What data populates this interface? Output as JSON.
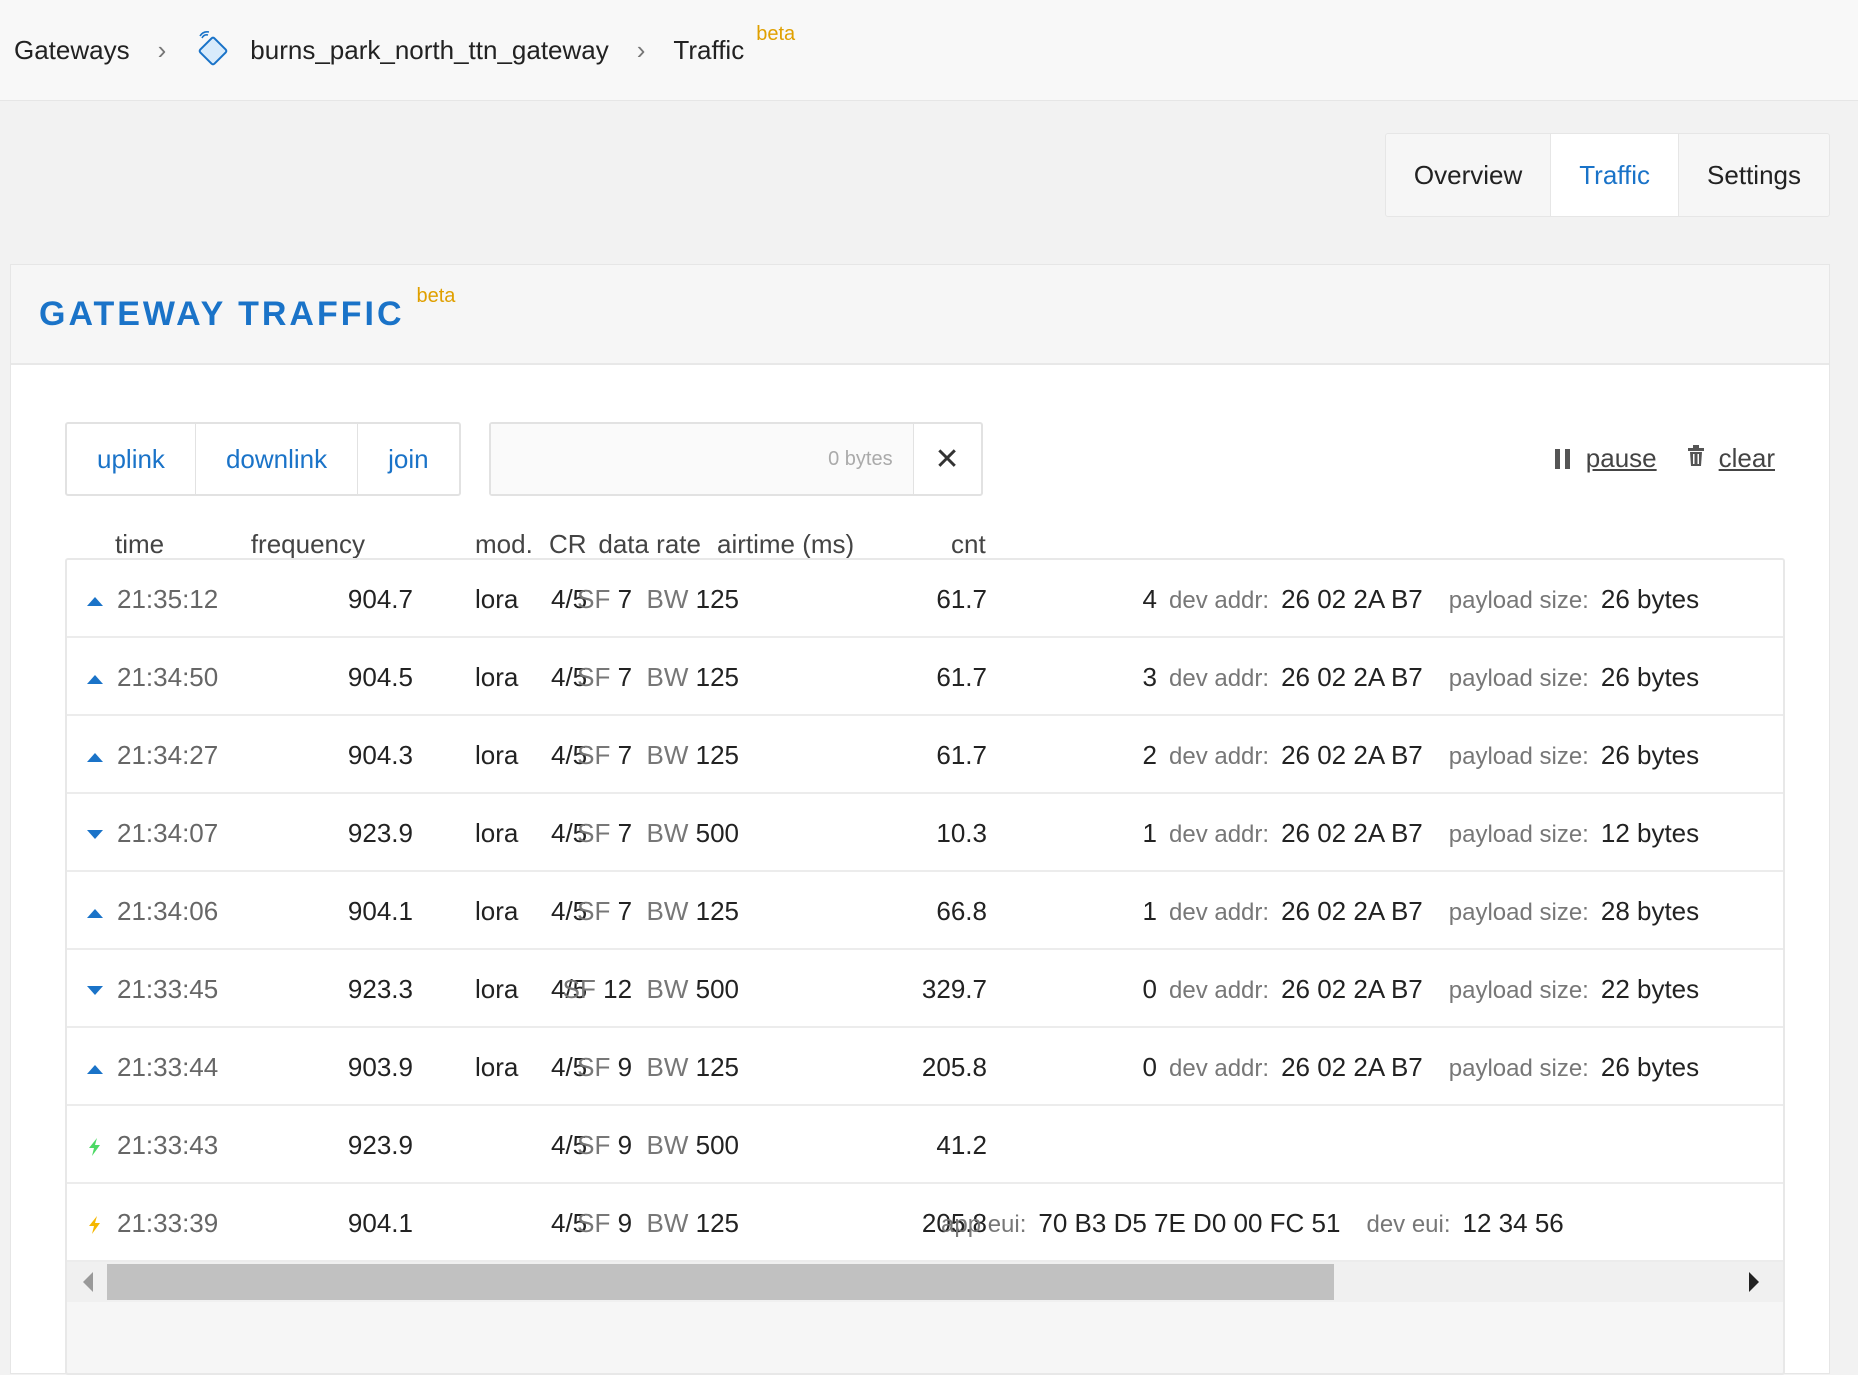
{
  "breadcrumb": {
    "gateways": "Gateways",
    "gateway_id": "burns_park_north_ttn_gateway",
    "current": "Traffic",
    "beta": "beta"
  },
  "tabs": [
    {
      "label": "Overview",
      "active": false
    },
    {
      "label": "Traffic",
      "active": true
    },
    {
      "label": "Settings",
      "active": false
    }
  ],
  "card": {
    "title": "GATEWAY TRAFFIC",
    "beta": "beta"
  },
  "filters": {
    "uplink": "uplink",
    "downlink": "downlink",
    "join": "join",
    "search_placeholder": "0 bytes",
    "clear_glyph": "✕"
  },
  "actions": {
    "pause": "pause",
    "clear": "clear"
  },
  "columns": {
    "time": "time",
    "frequency": "frequency",
    "mod": "mod.",
    "cr": "CR",
    "data_rate": "data rate",
    "airtime": "airtime (ms)",
    "cnt": "cnt"
  },
  "colors": {
    "accent": "#1a73c8",
    "beta": "#e0a000",
    "join_accept": "#4cd964",
    "join_request": "#f5b700"
  },
  "rows": [
    {
      "dir": "uplink-icon",
      "time": "21:35:12",
      "freq": "904.7",
      "mod": "lora",
      "cr": "4/5",
      "sf": "7",
      "bw": "125",
      "airtime": "61.7",
      "cnt": "4",
      "label1": "dev addr:",
      "value1": "26 02 2A B7",
      "label2": "payload size:",
      "value2": "26 bytes"
    },
    {
      "dir": "uplink-icon",
      "time": "21:34:50",
      "freq": "904.5",
      "mod": "lora",
      "cr": "4/5",
      "sf": "7",
      "bw": "125",
      "airtime": "61.7",
      "cnt": "3",
      "label1": "dev addr:",
      "value1": "26 02 2A B7",
      "label2": "payload size:",
      "value2": "26 bytes"
    },
    {
      "dir": "uplink-icon",
      "time": "21:34:27",
      "freq": "904.3",
      "mod": "lora",
      "cr": "4/5",
      "sf": "7",
      "bw": "125",
      "airtime": "61.7",
      "cnt": "2",
      "label1": "dev addr:",
      "value1": "26 02 2A B7",
      "label2": "payload size:",
      "value2": "26 bytes"
    },
    {
      "dir": "downlink-icon",
      "time": "21:34:07",
      "freq": "923.9",
      "mod": "lora",
      "cr": "4/5",
      "sf": "7",
      "bw": "500",
      "airtime": "10.3",
      "cnt": "1",
      "label1": "dev addr:",
      "value1": "26 02 2A B7",
      "label2": "payload size:",
      "value2": "12 bytes"
    },
    {
      "dir": "uplink-icon",
      "time": "21:34:06",
      "freq": "904.1",
      "mod": "lora",
      "cr": "4/5",
      "sf": "7",
      "bw": "125",
      "airtime": "66.8",
      "cnt": "1",
      "label1": "dev addr:",
      "value1": "26 02 2A B7",
      "label2": "payload size:",
      "value2": "28 bytes"
    },
    {
      "dir": "downlink-icon",
      "time": "21:33:45",
      "freq": "923.3",
      "mod": "lora",
      "cr": "4/5",
      "sf": "12",
      "bw": "500",
      "airtime": "329.7",
      "cnt": "0",
      "label1": "dev addr:",
      "value1": "26 02 2A B7",
      "label2": "payload size:",
      "value2": "22 bytes"
    },
    {
      "dir": "uplink-icon",
      "time": "21:33:44",
      "freq": "903.9",
      "mod": "lora",
      "cr": "4/5",
      "sf": "9",
      "bw": "125",
      "airtime": "205.8",
      "cnt": "0",
      "label1": "dev addr:",
      "value1": "26 02 2A B7",
      "label2": "payload size:",
      "value2": "26 bytes"
    },
    {
      "dir": "join-accept-icon",
      "time": "21:33:43",
      "freq": "923.9",
      "mod": "",
      "cr": "4/5",
      "sf": "9",
      "bw": "500",
      "airtime": "41.2",
      "cnt": "",
      "label1": "",
      "value1": "",
      "label2": "",
      "value2": ""
    },
    {
      "dir": "join-request-icon",
      "time": "21:33:39",
      "freq": "904.1",
      "mod": "",
      "cr": "4/5",
      "sf": "9",
      "bw": "125",
      "airtime": "205.8",
      "cnt": "",
      "label1": "app eui:",
      "value1": "70 B3 D5 7E D0 00 FC 51",
      "label2": "dev eui:",
      "value2": "12 34 56"
    }
  ],
  "scrollbar": {
    "position_fraction": 0.0,
    "visible_fraction": 0.75
  }
}
